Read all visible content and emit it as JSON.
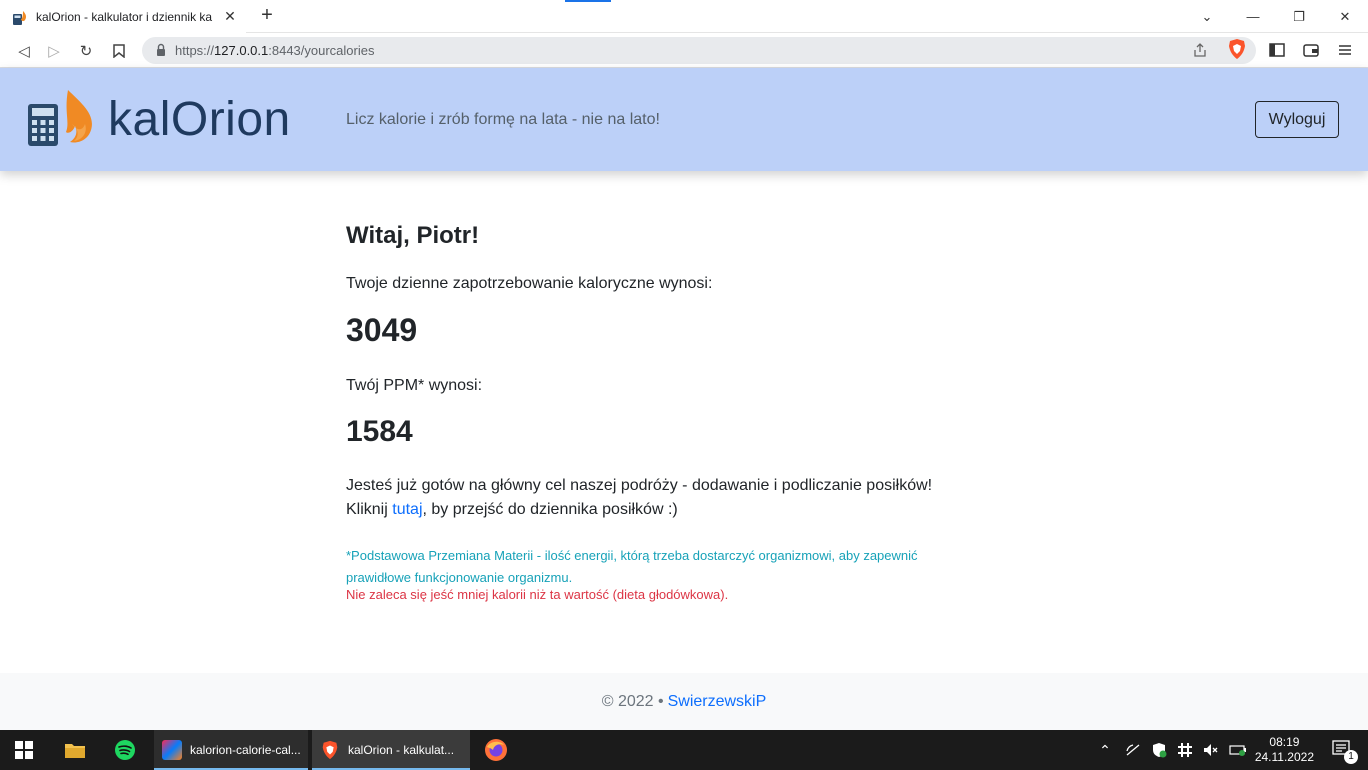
{
  "browser": {
    "tab_title": "kalOrion - kalkulator i dziennik ka",
    "tab_close": "✕",
    "new_tab": "+",
    "url_scheme": "https://",
    "url_host": "127.0.0.1",
    "url_rest": ":8443/yourcalories",
    "window_controls": {
      "collapse": "⌄",
      "minimize": "—",
      "restore": "❐",
      "close": "✕"
    },
    "nav": {
      "back": "◁",
      "forward": "▷",
      "reload": "↻",
      "bookmark": "🔖"
    }
  },
  "header": {
    "brand": "kalOrion",
    "tagline": "Licz kalorie i zrób formę na lata - nie na lato!",
    "logout_label": "Wyloguj"
  },
  "main": {
    "greeting": "Witaj, Piotr!",
    "daily_label": "Twoje dzienne zapotrzebowanie kaloryczne wynosi:",
    "daily_value": "3049",
    "ppm_label": "Twój PPM* wynosi:",
    "ppm_value": "1584",
    "goal_text": "Jesteś już gotów na główny cel naszej podróży - dodawanie i podliczanie posiłków!",
    "click_prefix": "Kliknij",
    "click_link": "tutaj",
    "click_suffix": ", by przejść do dziennika posiłków :)",
    "note_info": "*Podstawowa Przemiana Materii - ilość energii, którą trzeba dostarczyć organizmowi, aby zapewnić prawidłowe funkcjonowanie organizmu.",
    "note_warn": "Nie zaleca się jeść mniej kalorii niż ta wartość (dieta głodówkowa)."
  },
  "footer": {
    "copyright": "© 2022 •",
    "author": "SwierzewskiP"
  },
  "taskbar": {
    "app1": "kalorion-calorie-cal...",
    "app2": "kalOrion - kalkulat...",
    "time": "08:19",
    "date": "24.11.2022",
    "notif_count": "1"
  },
  "colors": {
    "header_bg": "#bcd0f8",
    "brand": "#1f3a5f",
    "link": "#0d6efd",
    "info": "#17a2b8",
    "danger": "#dc3545"
  }
}
